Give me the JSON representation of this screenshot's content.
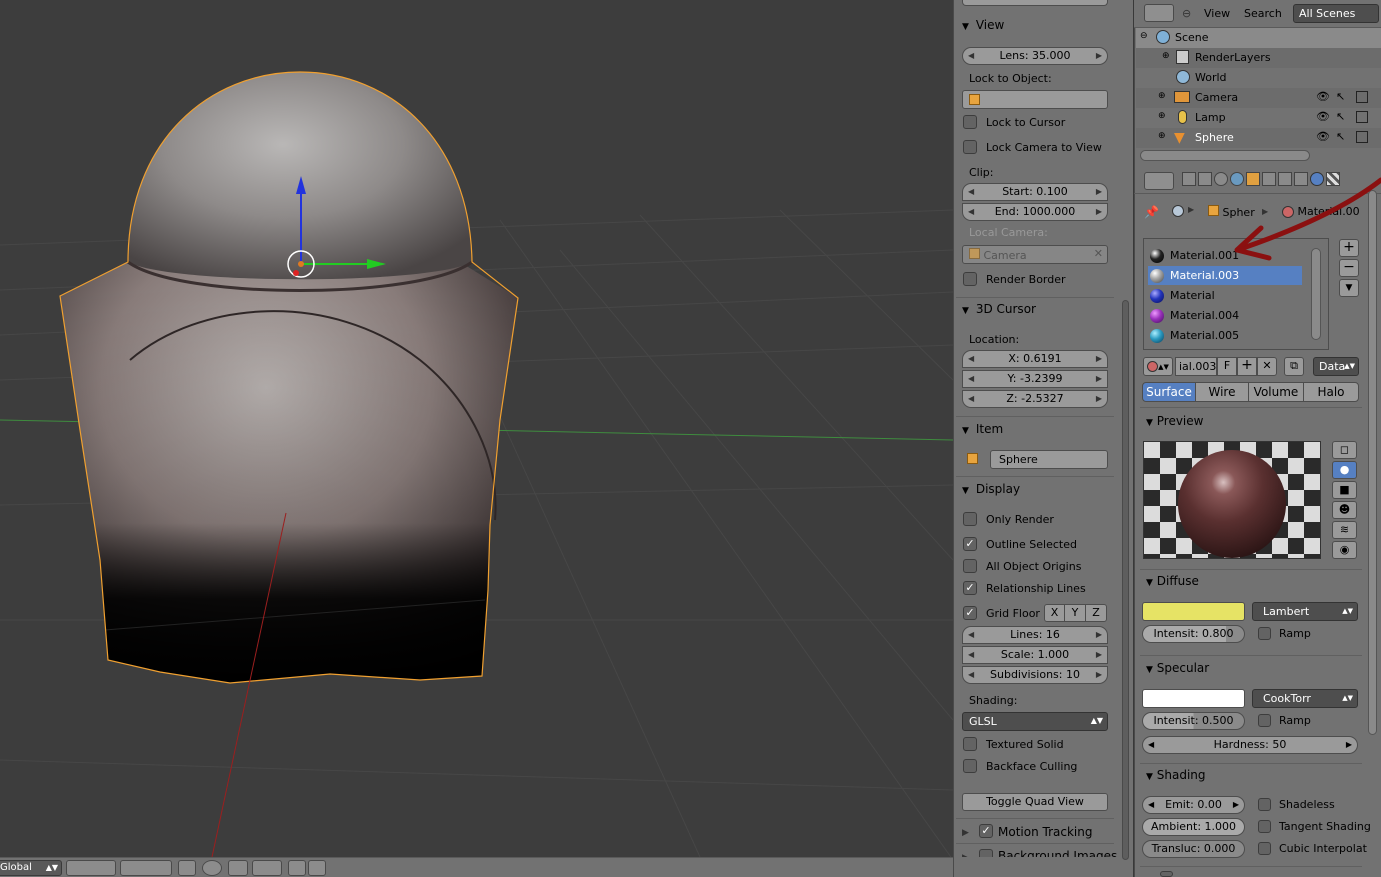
{
  "npanel": {
    "view_title": "View",
    "lens": "Lens: 35.000",
    "lock_to_object_label": "Lock to Object:",
    "lock_to_cursor": "Lock to Cursor",
    "lock_camera_to_view": "Lock Camera to View",
    "clip_label": "Clip:",
    "clip_start": "Start: 0.100",
    "clip_end": "End: 1000.000",
    "local_camera_label": "Local Camera:",
    "local_camera_value": "Camera",
    "render_border": "Render Border",
    "cursor_title": "3D Cursor",
    "location_label": "Location:",
    "loc_x": "X: 0.6191",
    "loc_y": "Y: -3.2399",
    "loc_z": "Z: -2.5327",
    "item_title": "Item",
    "item_name": "Sphere",
    "display_title": "Display",
    "only_render": "Only Render",
    "outline_selected": "Outline Selected",
    "all_object_origins": "All Object Origins",
    "relationship_lines": "Relationship Lines",
    "grid_floor": "Grid Floor",
    "axis_x": "X",
    "axis_y": "Y",
    "axis_z": "Z",
    "lines": "Lines: 16",
    "scale": "Scale: 1.000",
    "subdivisions": "Subdivisions: 10",
    "shading_label": "Shading:",
    "shading_value": "GLSL",
    "textured_solid": "Textured Solid",
    "backface_culling": "Backface Culling",
    "toggle_quad_view": "Toggle Quad View",
    "motion_tracking": "Motion Tracking",
    "background_images": "Background Images"
  },
  "viewport_header": {
    "orientation": "Global"
  },
  "outliner": {
    "view_menu": "View",
    "search_menu": "Search",
    "scenes_select": "All Scenes",
    "rows": [
      "Scene",
      "RenderLayers",
      "World",
      "Camera",
      "Lamp",
      "Sphere"
    ]
  },
  "properties": {
    "breadcrumb_object": "Spher",
    "breadcrumb_material": "Material.00",
    "materials": [
      "Material.001",
      "Material.003",
      "Material",
      "Material.004",
      "Material.005"
    ],
    "material_name_field": "ial.003",
    "fake_user": "F",
    "link_select": "Data",
    "tabs": [
      "Surface",
      "Wire",
      "Volume",
      "Halo"
    ],
    "preview_title": "Preview",
    "diffuse_title": "Diffuse",
    "diffuse_shader": "Lambert",
    "diffuse_intensity": "Intensit: 0.800",
    "diffuse_ramp": "Ramp",
    "diffuse_color": "#e6e365",
    "specular_title": "Specular",
    "specular_shader": "CookTorr",
    "specular_intensity": "Intensit: 0.500",
    "specular_ramp": "Ramp",
    "specular_color": "#ffffff",
    "hardness": "Hardness: 50",
    "shading_title": "Shading",
    "emit": "Emit: 0.00",
    "ambient": "Ambient: 1.000",
    "transluc": "Transluc: 0.000",
    "shadeless": "Shadeless",
    "tangent_shading": "Tangent Shading",
    "cubic_interpolat": "Cubic Interpolat"
  },
  "colors": {
    "accent": "#5680c2",
    "outline_selected": "#f0a030"
  }
}
